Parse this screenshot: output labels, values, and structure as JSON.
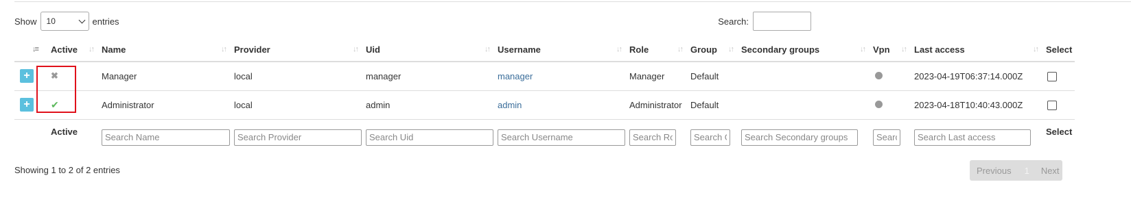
{
  "length": {
    "show": "Show",
    "value": "10",
    "entries": "entries"
  },
  "search": {
    "label": "Search:",
    "value": ""
  },
  "columns": {
    "active": "Active",
    "name": "Name",
    "provider": "Provider",
    "uid": "Uid",
    "username": "Username",
    "role": "Role",
    "group": "Group",
    "secondary": "Secondary groups",
    "vpn": "Vpn",
    "last_access": "Last access",
    "select": "Select"
  },
  "rows": [
    {
      "name": "Manager",
      "provider": "local",
      "uid": "manager",
      "username": "manager",
      "role": "Manager",
      "group": "Default",
      "secondary": "",
      "last_access": "2023-04-19T06:37:14.000Z",
      "active": false
    },
    {
      "name": "Administrator",
      "provider": "local",
      "uid": "admin",
      "username": "admin",
      "role": "Administrator",
      "group": "Default",
      "secondary": "",
      "last_access": "2023-04-18T10:40:43.000Z",
      "active": true
    }
  ],
  "footer": {
    "active": "Active",
    "select": "Select",
    "placeholders": {
      "name": "Search Name",
      "provider": "Search Provider",
      "uid": "Search Uid",
      "username": "Search Username",
      "role": "Search Role",
      "group": "Search Group",
      "secondary": "Search Secondary groups",
      "vpn": "Search Vpn",
      "last_access": "Search Last access"
    }
  },
  "info": "Showing 1 to 2 of 2 entries",
  "pagination": {
    "previous": "Previous",
    "page": "1",
    "next": "Next"
  },
  "colors": {
    "accent": "#5bc0de",
    "highlight": "#e0101a",
    "link": "#3a6d9a",
    "check": "#5cb85c"
  }
}
